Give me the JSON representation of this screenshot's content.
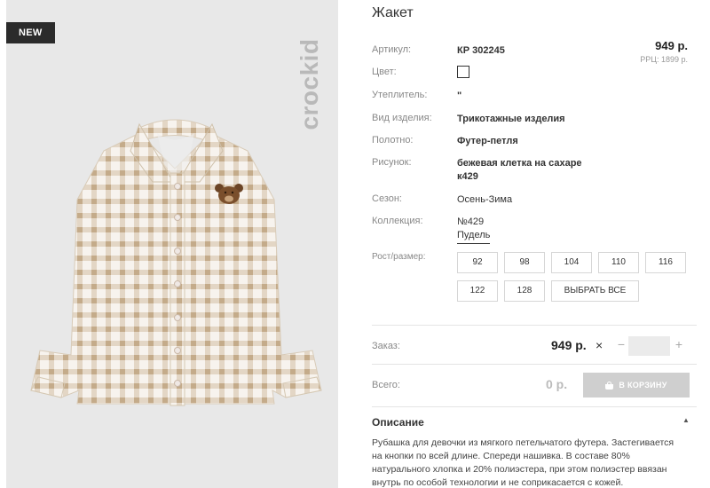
{
  "badge": "NEW",
  "brand": "crockid",
  "product": {
    "title": "Жакет",
    "price": "949 р.",
    "rrc": "РРЦ: 1899 р."
  },
  "specs": [
    {
      "label": "Артикул:",
      "value": "КР 302245"
    },
    {
      "label": "Цвет:",
      "value": ""
    },
    {
      "label": "Утеплитель:",
      "value": "\""
    },
    {
      "label": "Вид изделия:",
      "value": "Трикотажные изделия"
    },
    {
      "label": "Полотно:",
      "value": "Футер-петля"
    },
    {
      "label": "Рисунок:",
      "value": "бежевая клетка на сахаре к429"
    },
    {
      "label": "Сезон:",
      "value": "Осень-Зима"
    },
    {
      "label": "Коллекция:",
      "value": "№429 Пудель"
    }
  ],
  "sizes": {
    "label": "Рост/размер:",
    "options": [
      "92",
      "98",
      "104",
      "110",
      "116",
      "122",
      "128"
    ],
    "select_all": "ВЫБРАТЬ ВСЕ"
  },
  "order": {
    "label": "Заказ:",
    "price": "949 р.",
    "times": "×",
    "minus": "−",
    "plus": "+",
    "quantity": ""
  },
  "total": {
    "label": "Всего:",
    "value": "0 р.",
    "cart_button": "В КОРЗИНУ"
  },
  "description": {
    "title": "Описание",
    "toggle": "▲",
    "text": "Рубашка для девочки из мягкого петельчатого футера. Застегивается на кнопки по всей длине. Спереди нашивка. В составе 80% натурального хлопка и 20% полиэстера, при этом полиэстер ввязан внутрь по особой технологии и не соприкасается с кожей."
  },
  "colors": {
    "badge_bg": "#2b2b2b",
    "photo_bg": "#e8e8e8",
    "check_beige": "#cdb79a",
    "cart_button_bg": "#cfcfcf"
  }
}
